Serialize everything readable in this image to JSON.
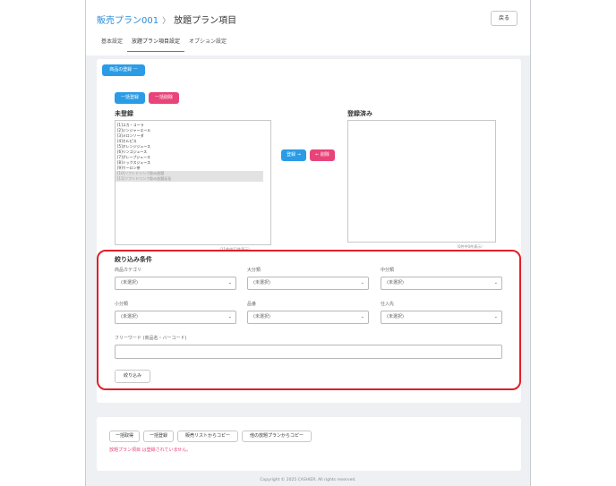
{
  "header": {
    "breadcrumb_link": "販売プラン001",
    "breadcrumb_sep": "〉",
    "breadcrumb_current": "放題プラン項目",
    "back_label": "戻る"
  },
  "tabs": [
    {
      "label": "基本設定"
    },
    {
      "label": "放題プラン項目設定"
    },
    {
      "label": "オプション設定"
    }
  ],
  "product_register_label": "商品の登録 ー",
  "bulk": {
    "register_label": "一括登録",
    "delete_label": "一括削除"
  },
  "unregistered": {
    "title": "未登録",
    "items": [
      {
        "label": "[1]コカ・コーラ"
      },
      {
        "label": "[2]ジンジャーエール"
      },
      {
        "label": "[3]メロンソーダ"
      },
      {
        "label": "[4]カルピス"
      },
      {
        "label": "[5]オレンジジュース"
      },
      {
        "label": "[6]リンゴジュース"
      },
      {
        "label": "[7]グレープジュース"
      },
      {
        "label": "[8]ミックスジュース"
      },
      {
        "label": "[9]ウーロン茶"
      },
      {
        "label": "[10]ソフトドリンク飲み放題"
      },
      {
        "label": "[11]ソフトドリンク飲み放題延長"
      }
    ],
    "count": "（11件中11件表示）"
  },
  "transfer": {
    "register_label": "登録 →",
    "delete_label": "← 削除"
  },
  "registered": {
    "title": "登録済み",
    "count": "（0件中0件表示）"
  },
  "filter": {
    "title": "絞り込み条件",
    "category_label": "商品カテゴリ",
    "category_value": "(未選択)",
    "major_label": "大分類",
    "major_value": "(未選択)",
    "middle_label": "中分類",
    "middle_value": "(未選択)",
    "minor_label": "小分類",
    "minor_value": "(未選択)",
    "item_label": "品番",
    "item_value": "(未選択)",
    "supplier_label": "仕入先",
    "supplier_value": "(未選択)",
    "keyword_label": "フリーワード (商品名・バーコード)",
    "keyword_value": "",
    "submit_label": "絞り込み"
  },
  "actions": {
    "bulk_get": "一括取得",
    "bulk_register": "一括登録",
    "copy_sales_list": "販売リストからコピー",
    "copy_other_plan": "他の放題プランからコピー"
  },
  "message": "放題プラン項目 は登録されていません。",
  "footer": "Copyright © 2025 CASHIER. All rights reserved.",
  "colors": {
    "accent": "#2a9ce6",
    "danger": "#e8447a",
    "highlight": "#e0202a"
  }
}
